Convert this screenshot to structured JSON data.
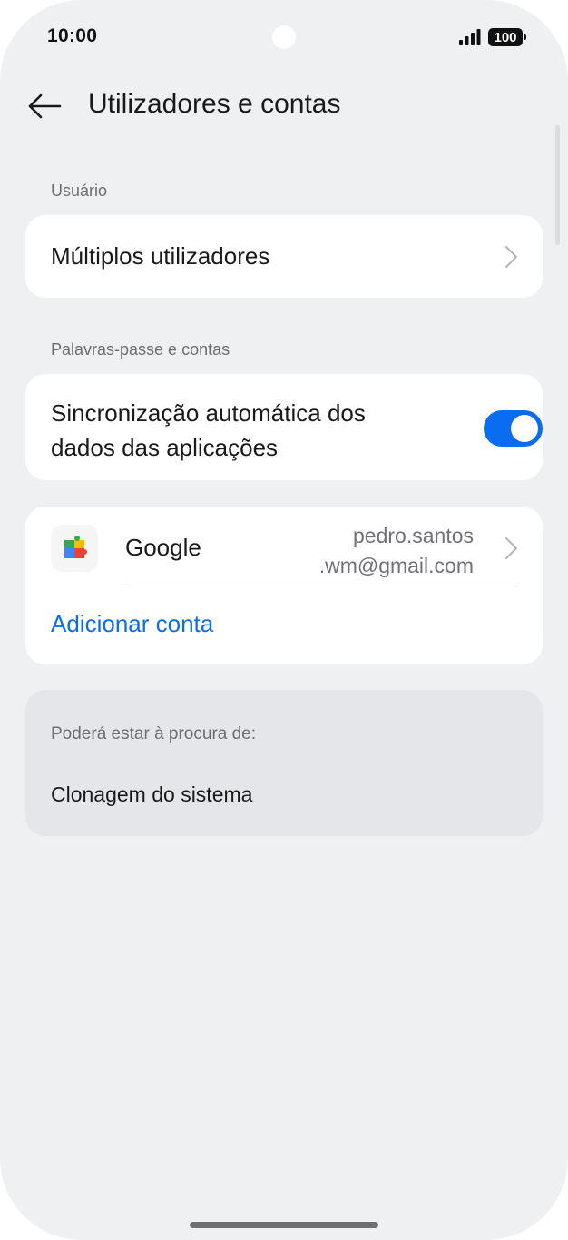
{
  "status_bar": {
    "time": "10:00",
    "battery_level": "100"
  },
  "header": {
    "title": "Utilizadores e contas",
    "back_icon": "arrow-left-icon"
  },
  "sections": {
    "user": {
      "label": "Usuário",
      "multi_users_label": "Múltiplos utilizadores"
    },
    "passwords": {
      "label": "Palavras-passe e contas",
      "sync_label_line1": "Sincronização automática dos",
      "sync_label_line2": "dados das aplicações",
      "sync_enabled": true
    },
    "accounts": {
      "google_label": "Google",
      "google_email_line1": "pedro.santos",
      "google_email_line2": ".wm@gmail.com",
      "add_account_label": "Adicionar conta"
    },
    "suggestions": {
      "label": "Poderá estar à procura de:",
      "item": "Clonagem do sistema"
    }
  },
  "colors": {
    "accent": "#0a6cf0",
    "background": "#eff0f2",
    "card": "#ffffff",
    "muted_text": "#6d6e72"
  }
}
